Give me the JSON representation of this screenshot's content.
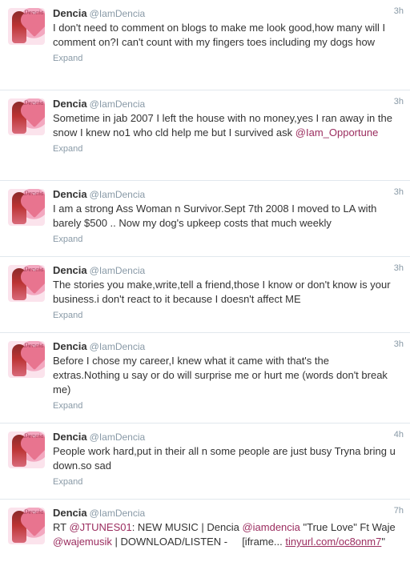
{
  "tweets": [
    {
      "name": "Dencia",
      "handle": "@IamDencia",
      "time": "3h",
      "text": "I don't need to comment on blogs to make me look good,how many will I comment on?I can't count with my fingers toes including my dogs how",
      "expand": "Expand"
    },
    {
      "name": "Dencia",
      "handle": "@IamDencia",
      "time": "3h",
      "text_a": "Sometime in jab 2007 I left the house with no money,yes I ran away in the snow I knew no1 who cld help me but I survived ask",
      "mention": "@Iam_Opportune",
      "expand": "Expand"
    },
    {
      "name": "Dencia",
      "handle": "@IamDencia",
      "time": "3h",
      "text": "I am a strong Ass Woman n Survivor.Sept 7th 2008 I moved to LA with barely $500 .. Now my dog's upkeep costs that much weekly",
      "expand": "Expand"
    },
    {
      "name": "Dencia",
      "handle": "@IamDencia",
      "time": "3h",
      "text": "The stories you make,write,tell a friend,those I know or don't know is your business.i don't react to it because I doesn't affect ME",
      "expand": "Expand"
    },
    {
      "name": "Dencia",
      "handle": "@IamDencia",
      "time": "3h",
      "text": "Before I chose my career,I knew what it came with that's the extras.Nothing u say or do will surprise me or hurt me (words don't break me)",
      "expand": "Expand"
    },
    {
      "name": "Dencia",
      "handle": "@IamDencia",
      "time": "4h",
      "text": "People work hard,put in their all n some people are just busy Tryna bring u down.so sad",
      "expand": "Expand"
    },
    {
      "name": "Dencia",
      "handle": "@IamDencia",
      "time": "7h",
      "rt": "RT",
      "mention1": "@JTUNES01",
      "text_b": ": NEW MUSIC | Dencia",
      "mention2": "@iamdencia",
      "text_c": "\"True Love\" Ft Waje",
      "mention3": "@wajemusik",
      "text_d": "| DOWNLOAD/LISTEN -     [iframe...",
      "link": "tinyurl.com/oc8onm7",
      "text_e": "\""
    }
  ],
  "colors": {
    "mention": "#9b2d5f",
    "muted": "#8899a6",
    "text": "#333333"
  },
  "icons": {
    "avatar": "profile-photo"
  }
}
